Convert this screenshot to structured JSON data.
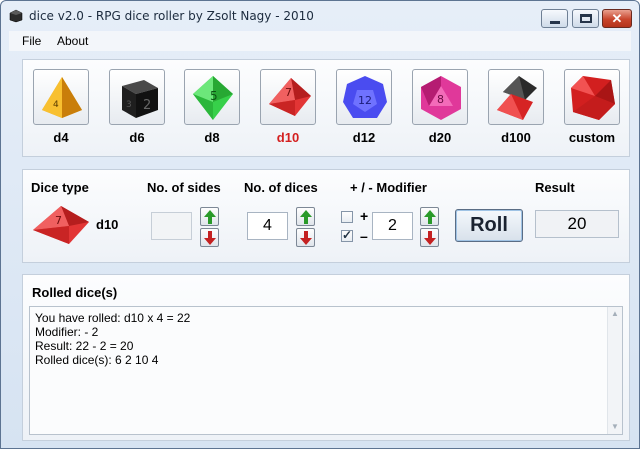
{
  "window": {
    "title": "dice v2.0 - RPG dice roller by Zsolt Nagy - 2010",
    "close_glyph": "✕"
  },
  "menu": [
    "File",
    "About"
  ],
  "dice": [
    {
      "label": "d4",
      "icon": "d4-die-icon",
      "color": "#e9a21b"
    },
    {
      "label": "d6",
      "icon": "d6-die-icon",
      "color": "#1a1a1a"
    },
    {
      "label": "d8",
      "icon": "d8-die-icon",
      "color": "#2bc63c"
    },
    {
      "label": "d10",
      "icon": "d10-die-icon",
      "color": "#d42020",
      "selected": true
    },
    {
      "label": "d12",
      "icon": "d12-die-icon",
      "color": "#3d3fe0"
    },
    {
      "label": "d20",
      "icon": "d20-die-icon",
      "color": "#d92a8c"
    },
    {
      "label": "d100",
      "icon": "d100-dice-icon",
      "color": "#c81e1e"
    },
    {
      "label": "custom",
      "icon": "custom-die-icon",
      "color": "#cc1c1c"
    }
  ],
  "controls": {
    "dice_type_header": "Dice type",
    "sides_header": "No. of sides",
    "count_header": "No. of dices",
    "modifier_header": "+ / - Modifier",
    "result_header": "Result",
    "selected_type": "d10",
    "sides_value": "",
    "count_value": "4",
    "plus_checked": false,
    "minus_checked": true,
    "plus_sign": "+",
    "minus_sign": "–",
    "modifier_value": "2",
    "roll_label": "Roll",
    "result_value": "20"
  },
  "output": {
    "title": "Rolled dice(s)",
    "lines": [
      "You have rolled: d10 x 4 = 22",
      "Modifier: - 2",
      "Result: 22 - 2 = 20",
      "Rolled dice(s):  6 2 10 4"
    ]
  },
  "colors": {
    "selected_label": "#d42020",
    "arrow_up": "#2a9a2a",
    "arrow_down": "#c42121"
  }
}
